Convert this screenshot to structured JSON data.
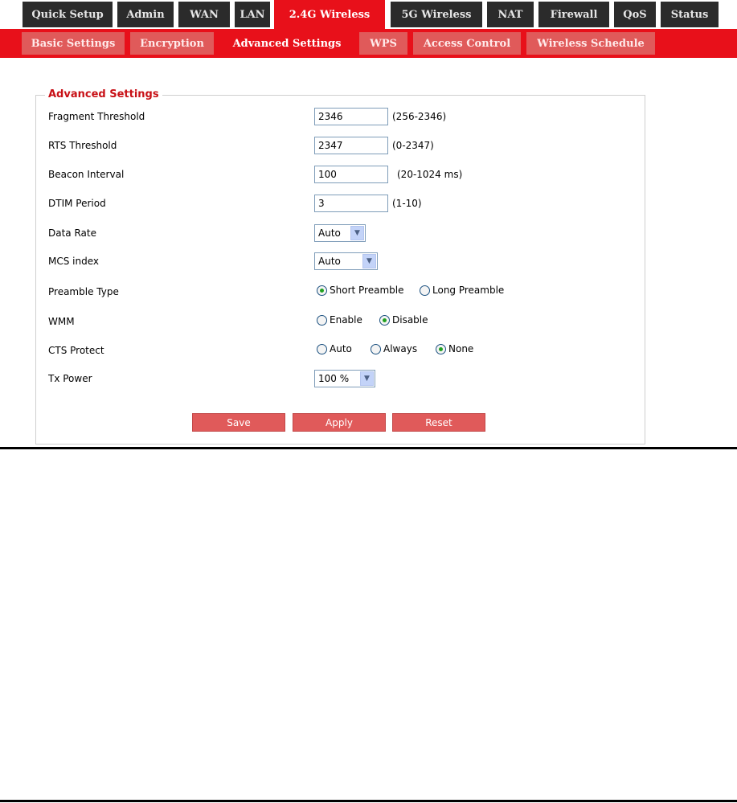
{
  "top_tabs": [
    "Quick Setup",
    "Admin",
    "WAN",
    "LAN",
    "2.4G Wireless",
    "5G Wireless",
    "NAT",
    "Firewall",
    "QoS",
    "Status"
  ],
  "sub_tabs": [
    "Basic Settings",
    "Encryption",
    "Advanced Settings",
    "WPS",
    "Access Control",
    "Wireless Schedule"
  ],
  "section_title": "Advanced Settings",
  "fields": {
    "fragment": {
      "label": "Fragment Threshold",
      "value": "2346",
      "hint": "(256-2346)"
    },
    "rts": {
      "label": "RTS Threshold",
      "value": "2347",
      "hint": "(0-2347)"
    },
    "beacon": {
      "label": "Beacon Interval",
      "value": "100",
      "hint": "(20-1024 ms)"
    },
    "dtim": {
      "label": "DTIM Period",
      "value": "3",
      "hint": "(1-10)"
    },
    "data_rate": {
      "label": "Data Rate",
      "selected": "Auto"
    },
    "mcs": {
      "label": "MCS index",
      "selected": "Auto"
    },
    "preamble": {
      "label": "Preamble Type",
      "options": [
        "Short Preamble",
        "Long Preamble"
      ],
      "selected": "Short Preamble"
    },
    "wmm": {
      "label": "WMM",
      "options": [
        "Enable",
        "Disable"
      ],
      "selected": "Disable"
    },
    "cts": {
      "label": "CTS Protect",
      "options": [
        "Auto",
        "Always",
        "None"
      ],
      "selected": "None"
    },
    "tx_power": {
      "label": "Tx Power",
      "selected": "100 %"
    }
  },
  "buttons": {
    "save": "Save",
    "apply": "Apply",
    "reset": "Reset"
  },
  "colors": {
    "accent_red": "#e8101a",
    "tab_dark": "#2b2b2b",
    "sub_tab_inactive": "#e05a5a",
    "legend_red": "#c81016",
    "radio_dot": "#21a121"
  },
  "icons": {
    "select_arrow": "chevron-down-icon"
  }
}
